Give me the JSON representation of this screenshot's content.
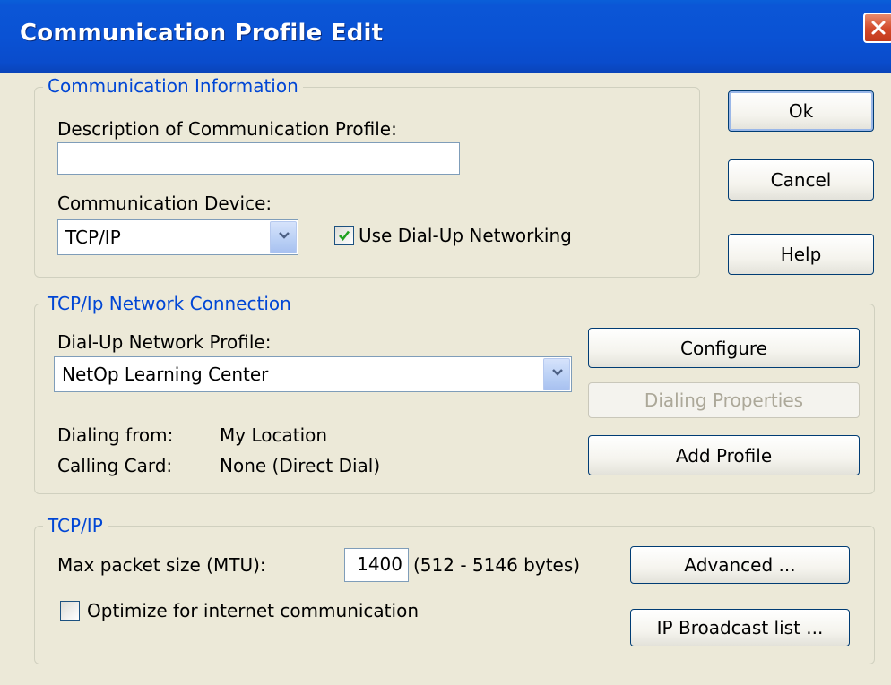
{
  "window": {
    "title": "Communication Profile Edit"
  },
  "buttons": {
    "ok": "Ok",
    "cancel": "Cancel",
    "help": "Help",
    "configure": "Configure",
    "dialing_properties": "Dialing Properties",
    "add_profile": "Add Profile",
    "advanced": "Advanced ...",
    "ip_broadcast": "IP Broadcast list ..."
  },
  "communication_info": {
    "legend": "Communication Information",
    "description_label": "Description of Communication Profile:",
    "description_value": "",
    "device_label": "Communication Device:",
    "device_value": "TCP/IP",
    "dialup_checkbox_label": "Use Dial-Up Networking",
    "dialup_checked": true
  },
  "network_connection": {
    "legend": "TCP/Ip Network Connection",
    "profile_label": "Dial-Up Network Profile:",
    "profile_value": "NetOp Learning Center",
    "dialing_from_label": "Dialing from:",
    "dialing_from_value": "My Location",
    "calling_card_label": "Calling Card:",
    "calling_card_value": "None (Direct Dial)"
  },
  "tcpip": {
    "legend": "TCP/IP",
    "mtu_label": "Max packet size (MTU):",
    "mtu_value": "1400",
    "mtu_range": "(512 - 5146 bytes)",
    "optimize_label": "Optimize for internet communication",
    "optimize_checked": false
  },
  "colors": {
    "titlebar": "#0a52d4",
    "legend_text": "#0046d5",
    "dialog_bg": "#ece9d8",
    "check_green": "#21a121"
  }
}
